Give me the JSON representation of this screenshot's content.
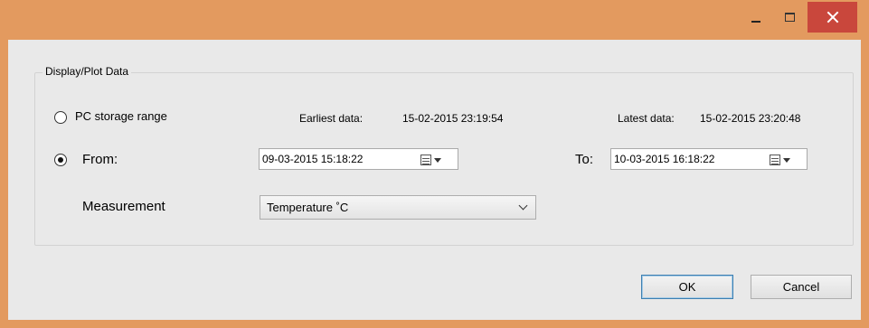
{
  "window": {
    "controls": {
      "minimize_icon": "minimize-icon",
      "maximize_icon": "maximize-icon",
      "close_icon": "close-icon"
    },
    "colors": {
      "chrome": "#e39a5f",
      "close": "#c9473c",
      "client": "#e9e9e9"
    }
  },
  "group": {
    "title": "Display/Plot Data"
  },
  "range": {
    "pc_storage_label": "PC storage range",
    "earliest_label": "Earliest data:",
    "earliest_value": "15-02-2015 23:19:54",
    "latest_label": "Latest data:",
    "latest_value": "15-02-2015 23:20:48",
    "from_label": "From:",
    "from_value": "09-03-2015 15:18:22",
    "to_label": "To:",
    "to_value": "10-03-2015 16:18:22",
    "selected": "from"
  },
  "measurement": {
    "label": "Measurement",
    "selected": "Temperature ˚C"
  },
  "buttons": {
    "ok": "OK",
    "cancel": "Cancel"
  }
}
